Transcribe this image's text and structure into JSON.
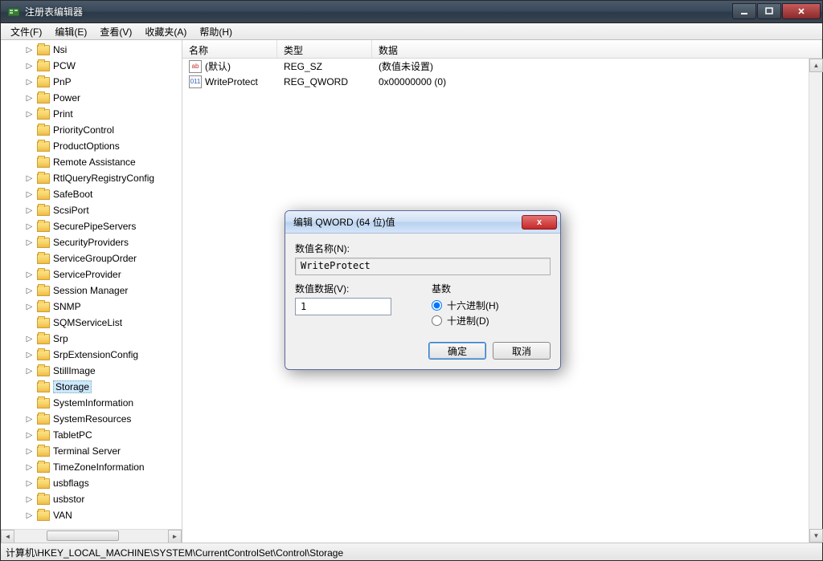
{
  "window": {
    "title": "注册表编辑器"
  },
  "menu": {
    "file": "文件(F)",
    "edit": "编辑(E)",
    "view": "查看(V)",
    "favorites": "收藏夹(A)",
    "help": "帮助(H)"
  },
  "tree": {
    "items": [
      {
        "label": "Nsi",
        "expandable": true,
        "selected": false
      },
      {
        "label": "PCW",
        "expandable": true,
        "selected": false
      },
      {
        "label": "PnP",
        "expandable": true,
        "selected": false
      },
      {
        "label": "Power",
        "expandable": true,
        "selected": false
      },
      {
        "label": "Print",
        "expandable": true,
        "selected": false
      },
      {
        "label": "PriorityControl",
        "expandable": false,
        "selected": false
      },
      {
        "label": "ProductOptions",
        "expandable": false,
        "selected": false
      },
      {
        "label": "Remote Assistance",
        "expandable": false,
        "selected": false
      },
      {
        "label": "RtlQueryRegistryConfig",
        "expandable": true,
        "selected": false
      },
      {
        "label": "SafeBoot",
        "expandable": true,
        "selected": false
      },
      {
        "label": "ScsiPort",
        "expandable": true,
        "selected": false
      },
      {
        "label": "SecurePipeServers",
        "expandable": true,
        "selected": false
      },
      {
        "label": "SecurityProviders",
        "expandable": true,
        "selected": false
      },
      {
        "label": "ServiceGroupOrder",
        "expandable": false,
        "selected": false
      },
      {
        "label": "ServiceProvider",
        "expandable": true,
        "selected": false
      },
      {
        "label": "Session Manager",
        "expandable": true,
        "selected": false
      },
      {
        "label": "SNMP",
        "expandable": true,
        "selected": false
      },
      {
        "label": "SQMServiceList",
        "expandable": false,
        "selected": false
      },
      {
        "label": "Srp",
        "expandable": true,
        "selected": false
      },
      {
        "label": "SrpExtensionConfig",
        "expandable": true,
        "selected": false
      },
      {
        "label": "StillImage",
        "expandable": true,
        "selected": false
      },
      {
        "label": "Storage",
        "expandable": false,
        "selected": true
      },
      {
        "label": "SystemInformation",
        "expandable": false,
        "selected": false
      },
      {
        "label": "SystemResources",
        "expandable": true,
        "selected": false
      },
      {
        "label": "TabletPC",
        "expandable": true,
        "selected": false
      },
      {
        "label": "Terminal Server",
        "expandable": true,
        "selected": false
      },
      {
        "label": "TimeZoneInformation",
        "expandable": true,
        "selected": false
      },
      {
        "label": "usbflags",
        "expandable": true,
        "selected": false
      },
      {
        "label": "usbstor",
        "expandable": true,
        "selected": false
      },
      {
        "label": "VAN",
        "expandable": true,
        "selected": false
      }
    ]
  },
  "columns": {
    "name": "名称",
    "type": "类型",
    "data": "数据"
  },
  "values": [
    {
      "icon": "str",
      "iconText": "ab",
      "name": "(默认)",
      "type": "REG_SZ",
      "data": "(数值未设置)"
    },
    {
      "icon": "bin",
      "iconText": "011",
      "name": "WriteProtect",
      "type": "REG_QWORD",
      "data": "0x00000000 (0)"
    }
  ],
  "statusbar": {
    "path": "计算机\\HKEY_LOCAL_MACHINE\\SYSTEM\\CurrentControlSet\\Control\\Storage"
  },
  "dialog": {
    "title": "编辑 QWORD (64 位)值",
    "nameLabel": "数值名称(N):",
    "nameValue": "WriteProtect",
    "dataLabel": "数值数据(V):",
    "dataValue": "1",
    "baseLabel": "基数",
    "hexLabel": "十六进制(H)",
    "decLabel": "十进制(D)",
    "ok": "确定",
    "cancel": "取消"
  }
}
